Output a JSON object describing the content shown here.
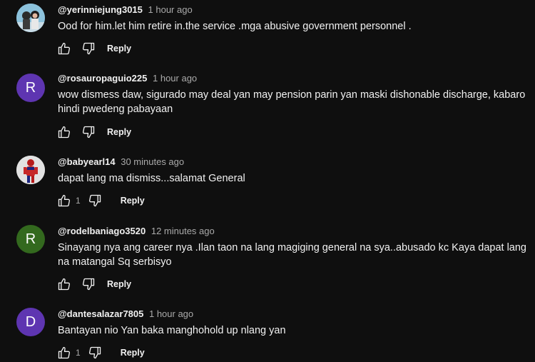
{
  "comments": [
    {
      "handle": "@yerinniejung3015",
      "time": "1 hour ago",
      "text": "Ood for him.let him retire in.the service .mga abusive government personnel .",
      "likes": "",
      "reply_label": "Reply",
      "avatar": {
        "type": "photo",
        "letter": "",
        "color": "#6fa9c9"
      }
    },
    {
      "handle": "@rosauropaguio225",
      "time": "1 hour ago",
      "text": "wow dismess daw,  sigurado may deal yan may pension parin yan maski dishonable discharge, kabaro hindi pwedeng pabayaan",
      "likes": "",
      "reply_label": "Reply",
      "avatar": {
        "type": "letter",
        "letter": "R",
        "color": "#5e35b1"
      }
    },
    {
      "handle": "@babyearl14",
      "time": "30 minutes ago",
      "text": "dapat lang ma dismiss...salamat General",
      "likes": "1",
      "reply_label": "Reply",
      "avatar": {
        "type": "photo",
        "letter": "",
        "color": "#d8d8d8"
      }
    },
    {
      "handle": "@rodelbaniago3520",
      "time": "12 minutes ago",
      "text": "Sinayang nya ang career nya .Ilan taon na lang magiging general na sya..abusado kc Kaya dapat lang na matangal Sq serbisyo",
      "likes": "",
      "reply_label": "Reply",
      "avatar": {
        "type": "letter",
        "letter": "R",
        "color": "#33691e"
      }
    },
    {
      "handle": "@dantesalazar7805",
      "time": "1 hour ago",
      "text": "Bantayan nio Yan baka manghohold up nlang yan",
      "likes": "1",
      "reply_label": "Reply",
      "avatar": {
        "type": "letter",
        "letter": "D",
        "color": "#5e35b1"
      }
    }
  ],
  "icons": {
    "like": "thumbs-up-icon",
    "dislike": "thumbs-down-icon"
  }
}
